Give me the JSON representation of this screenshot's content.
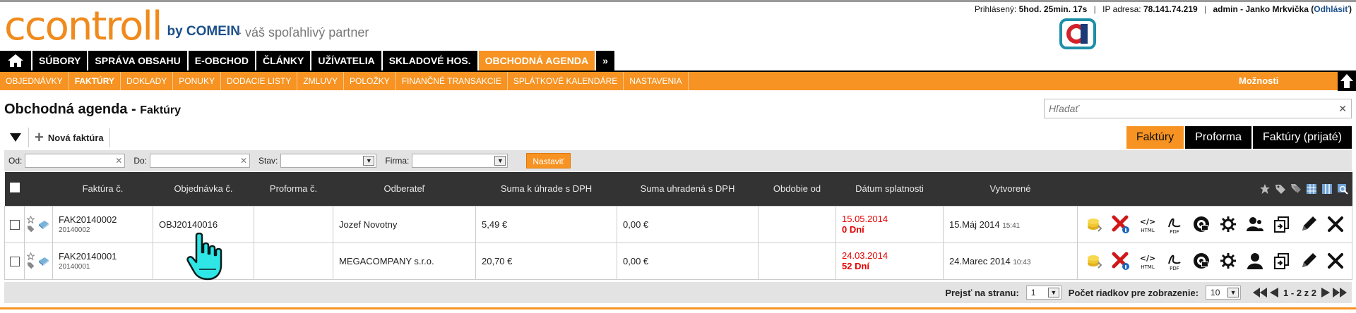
{
  "header": {
    "logo_text": "ccontroll",
    "logo_by": "by COMEIN",
    "tagline": "- váš spoľahlivý partner",
    "login_label": "Prihlásený:",
    "login_time": "5hod. 25min. 17s",
    "ip_label": "IP adresa:",
    "ip_value": "78.141.74.219",
    "user": "admin - Janko Mrkvička",
    "logout": "Odhlásiť"
  },
  "mainnav": {
    "items": [
      {
        "label": "SÚBORY"
      },
      {
        "label": "SPRÁVA OBSAHU"
      },
      {
        "label": "E-OBCHOD"
      },
      {
        "label": "ČLÁNKY"
      },
      {
        "label": "UŽÍVATELIA"
      },
      {
        "label": "SKLADOVÉ HOS."
      },
      {
        "label": "OBCHODNÁ AGENDA"
      },
      {
        "label": "»"
      }
    ],
    "active_index": 6
  },
  "subnav": {
    "items": [
      {
        "label": "OBJEDNÁVKY"
      },
      {
        "label": "FAKTÚRY"
      },
      {
        "label": "DOKLADY"
      },
      {
        "label": "PONUKY"
      },
      {
        "label": "DODACIE LISTY"
      },
      {
        "label": "ZMLUVY"
      },
      {
        "label": "POLOŽKY"
      },
      {
        "label": "FINANČNÉ TRANSAKCIE"
      },
      {
        "label": "SPLÁTKOVÉ KALENDÁRE"
      },
      {
        "label": "NASTAVENIA"
      }
    ],
    "active_index": 1,
    "options_label": "Možnosti"
  },
  "page": {
    "title": "Obchodná agenda -",
    "subtitle": "Faktúry",
    "search_placeholder": "Hľadať",
    "new_invoice": "Nová faktúra"
  },
  "tabs": [
    {
      "label": "Faktúry",
      "active": true
    },
    {
      "label": "Proforma",
      "active": false
    },
    {
      "label": "Faktúry (prijaté)",
      "active": false
    }
  ],
  "filter": {
    "from_label": "Od:",
    "to_label": "Do:",
    "state_label": "Stav:",
    "company_label": "Firma:",
    "set_button": "Nastaviť"
  },
  "table": {
    "columns": [
      "Faktúra č.",
      "Objednávka č.",
      "Proforma č.",
      "Odberateľ",
      "Suma k úhrade s DPH",
      "Suma uhradená s DPH",
      "Obdobie od",
      "Dátum splatnosti",
      "Vytvorené"
    ],
    "rows": [
      {
        "invoice": "FAK20140002",
        "invoice_sub": "20140002",
        "order": "OBJ20140016",
        "proforma": "",
        "customer": "Jozef Novotny",
        "amount_due": "5,49 €",
        "amount_paid": "0,00 €",
        "period_from": "",
        "due_date": "15.05.2014",
        "due_days": "0 Dní",
        "created": "15.Máj 2014",
        "created_time": "15:41"
      },
      {
        "invoice": "FAK20140001",
        "invoice_sub": "20140001",
        "order": "",
        "proforma": "",
        "customer": "MEGACOMPANY s.r.o.",
        "amount_due": "20,70 €",
        "amount_paid": "0,00 €",
        "period_from": "",
        "due_date": "24.03.2014",
        "due_days": "52 Dní",
        "created": "24.Marec 2014",
        "created_time": "10:43"
      }
    ],
    "action_icons": [
      "coins-icon",
      "delete-info-icon",
      "html-icon",
      "pdf-icon",
      "email-icon",
      "settings-icon",
      "users-icon",
      "copy-icon",
      "edit-icon",
      "close-icon"
    ]
  },
  "pager": {
    "goto_label": "Prejsť na stranu:",
    "goto_value": "1",
    "rows_label": "Počet riadkov pre zobrazenie:",
    "rows_value": "10",
    "range": "1 - 2 z 2"
  },
  "colors": {
    "accent": "#f79322",
    "dark": "#000000",
    "header_row": "#333333",
    "due_red": "#e60000",
    "brand_blue": "#1b4f8a"
  }
}
